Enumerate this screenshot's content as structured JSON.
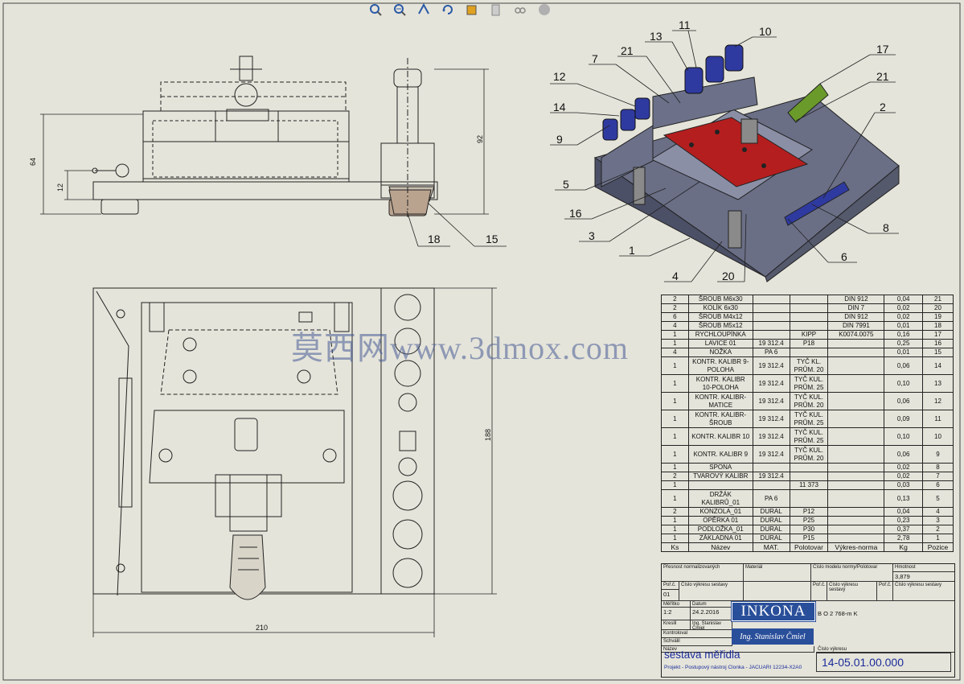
{
  "toolbar": {
    "items": [
      {
        "icon": "zoom-to-fit-icon"
      },
      {
        "icon": "zoom-to-area-icon"
      },
      {
        "icon": "previous-view-icon"
      },
      {
        "icon": "rotate-view-icon"
      },
      {
        "icon": "display-style-icon"
      },
      {
        "icon": "hide-show-items-icon"
      },
      {
        "icon": "edit-appearance-icon"
      },
      {
        "icon": "apply-scene-icon"
      }
    ]
  },
  "dimensions": {
    "height_total": "64",
    "base_thickness": "12",
    "side_height": "92",
    "plan_height": "188",
    "plan_width": "210"
  },
  "balloons": [
    "11",
    "10",
    "13",
    "21",
    "7",
    "17",
    "12",
    "21",
    "14",
    "2",
    "9",
    "5",
    "16",
    "3",
    "8",
    "1",
    "6",
    "4",
    "20",
    "18",
    "15"
  ],
  "bom": {
    "rows": [
      {
        "qty": "2",
        "name": "ŠROUB M6x30",
        "mat": "",
        "semi": "",
        "draw": "DIN 912",
        "kg": "0,04",
        "pos": "21"
      },
      {
        "qty": "2",
        "name": "KOLÍK 6x30",
        "mat": "",
        "semi": "",
        "draw": "DIN 7",
        "kg": "0,02",
        "pos": "20"
      },
      {
        "qty": "6",
        "name": "ŠROUB M4x12",
        "mat": "",
        "semi": "",
        "draw": "DIN 912",
        "kg": "0,02",
        "pos": "19"
      },
      {
        "qty": "4",
        "name": "ŠROUB M5x12",
        "mat": "",
        "semi": "",
        "draw": "DIN 7991",
        "kg": "0,01",
        "pos": "18"
      },
      {
        "qty": "1",
        "name": "RYCHLOUPÍNKA",
        "mat": "",
        "semi": "KIPP",
        "draw": "K0074.0075",
        "kg": "0,16",
        "pos": "17"
      },
      {
        "qty": "1",
        "name": "LAVICE 01",
        "mat": "19 312.4",
        "semi": "P18",
        "draw": "",
        "kg": "0,25",
        "pos": "16"
      },
      {
        "qty": "4",
        "name": "NOŽKA",
        "mat": "PA 6",
        "semi": "",
        "draw": "",
        "kg": "0,01",
        "pos": "15"
      },
      {
        "qty": "1",
        "name": "KONTR. KALIBR 9-\nPOLOHA",
        "mat": "19 312.4",
        "semi": "TYČ KL.\nPRŮM. 20",
        "draw": "",
        "kg": "0,06",
        "pos": "14"
      },
      {
        "qty": "1",
        "name": "KONTR. KALIBR\n10-POLOHA",
        "mat": "19 312.4",
        "semi": "TYČ KUL.\nPRŮM. 25",
        "draw": "",
        "kg": "0,10",
        "pos": "13"
      },
      {
        "qty": "1",
        "name": "KONTR. KALIBR-\nMATICE",
        "mat": "19 312.4",
        "semi": "TYČ KUL.\nPRŮM. 20",
        "draw": "",
        "kg": "0,06",
        "pos": "12"
      },
      {
        "qty": "1",
        "name": "KONTR. KALIBR-\nŠROUB",
        "mat": "19 312.4",
        "semi": "TYČ KUL.\nPRŮM. 25",
        "draw": "",
        "kg": "0,09",
        "pos": "11"
      },
      {
        "qty": "1",
        "name": "KONTR. KALIBR 10",
        "mat": "19 312.4",
        "semi": "TYČ KUL.\nPRŮM. 25",
        "draw": "",
        "kg": "0,10",
        "pos": "10"
      },
      {
        "qty": "1",
        "name": "KONTR. KALIBR 9",
        "mat": "19 312.4",
        "semi": "TYČ KUL.\nPRŮM. 20",
        "draw": "",
        "kg": "0,06",
        "pos": "9"
      },
      {
        "qty": "1",
        "name": "SPONA",
        "mat": "",
        "semi": "",
        "draw": "",
        "kg": "0,02",
        "pos": "8"
      },
      {
        "qty": "2",
        "name": "TVAROVÝ KALIBR",
        "mat": "19 312.4",
        "semi": "",
        "draw": "",
        "kg": "0,02",
        "pos": "7"
      },
      {
        "qty": "1",
        "name": "",
        "mat": "",
        "semi": "11 373",
        "draw": "",
        "kg": "0,03",
        "pos": "6"
      },
      {
        "qty": "1",
        "name": "DRŽÁK\nKALIBRŮ_01",
        "mat": "PA 6",
        "semi": "",
        "draw": "",
        "kg": "0,13",
        "pos": "5"
      },
      {
        "qty": "2",
        "name": "KONZOLA_01",
        "mat": "DURAL",
        "semi": "P12",
        "draw": "",
        "kg": "0,04",
        "pos": "4"
      },
      {
        "qty": "1",
        "name": "OPĚRKA 01",
        "mat": "DURAL",
        "semi": "P25",
        "draw": "",
        "kg": "0,23",
        "pos": "3"
      },
      {
        "qty": "1",
        "name": "PODLOŽKA_01",
        "mat": "DURAL",
        "semi": "P30",
        "draw": "",
        "kg": "0,37",
        "pos": "2"
      },
      {
        "qty": "1",
        "name": "ZÁKLADNA 01",
        "mat": "DURAL",
        "semi": "P15",
        "draw": "",
        "kg": "2,78",
        "pos": "1"
      }
    ],
    "header": {
      "qty": "Ks",
      "name": "Název",
      "mat": "MAT.",
      "semi": "Polotovar",
      "draw": "Výkres-norma",
      "kg": "Kg",
      "pos": "Pozice"
    }
  },
  "title_block": {
    "tolerance_label": "Přesnost normalizovaných",
    "material_label": "Materiál",
    "norm_label": "Číslo modelu normy/Polotovar",
    "mass_label": "Hmotnost",
    "mass_value": "3,879",
    "index_label": "Poř.č.",
    "index_value": "01",
    "drawing_no_label": "Číslo výkresu sestavy",
    "scale_label": "Měřítko",
    "scale_value": "1:2",
    "date_label": "Datum",
    "date_value": "24.2.2016",
    "drawn_label": "Kreslil",
    "drawn_value": "Ing. Stanislav Čmiel",
    "checked_label": "Kontroloval",
    "approved_label": "Schválil",
    "company": "INKONA",
    "signature": "Ing. Stanislav Čmiel",
    "order_label": "B O 2 768-m K",
    "name_label": "Název",
    "title": "sestava měřidla",
    "project": "Projekt - Postupový nástroj Clonka - JACUARI 12234-X2A0",
    "doc_label": "Číslo výkresu",
    "doc_number": "14-05.01.00.000"
  },
  "watermark": "莫西网www.3dmox.com"
}
